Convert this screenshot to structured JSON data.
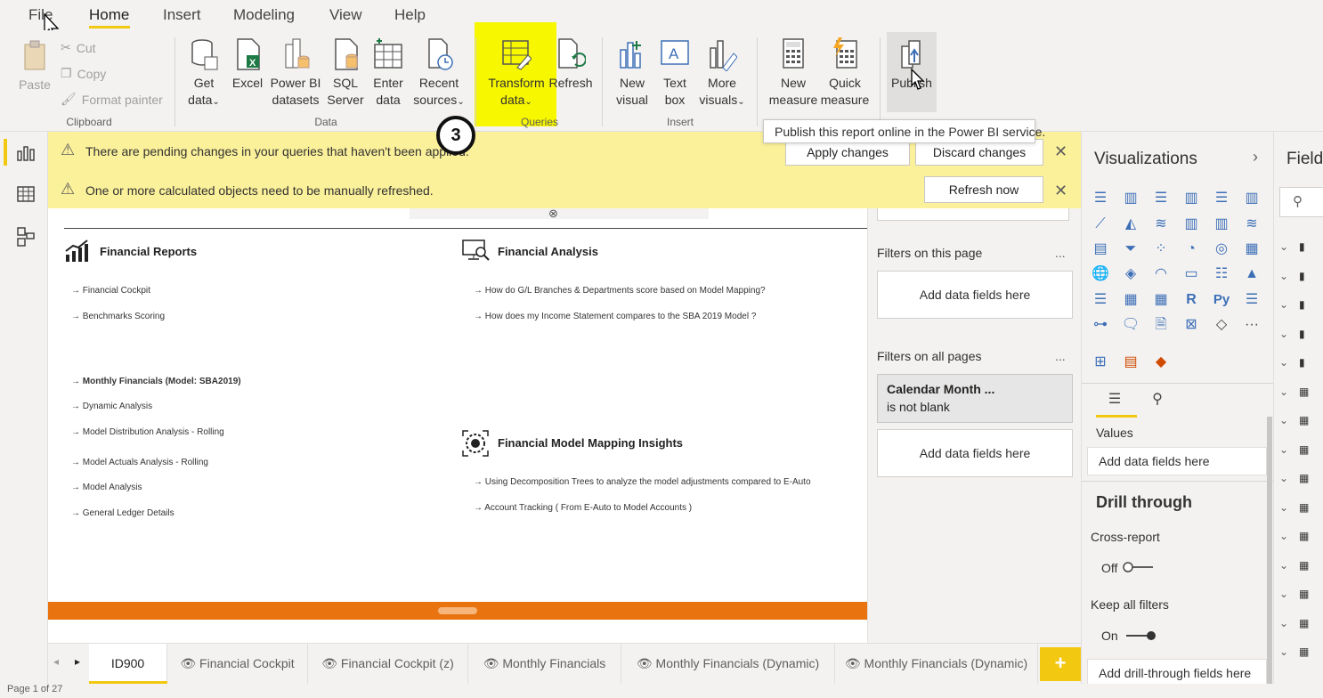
{
  "menu": {
    "file": "File",
    "home": "Home",
    "insert": "Insert",
    "modeling": "Modeling",
    "view": "View",
    "help": "Help"
  },
  "ribbon": {
    "clipboard": {
      "paste": "Paste",
      "cut": "Cut",
      "copy": "Copy",
      "format_painter": "Format painter",
      "group_label": "Clipboard"
    },
    "data": {
      "get_data": [
        "Get",
        "data"
      ],
      "excel": "Excel",
      "power_bi_datasets": [
        "Power BI",
        "datasets"
      ],
      "sql_server": [
        "SQL",
        "Server"
      ],
      "enter_data": [
        "Enter",
        "data"
      ],
      "recent_sources": [
        "Recent",
        "sources"
      ],
      "group_label": "Data"
    },
    "queries": {
      "transform_data": [
        "Transform",
        "data"
      ],
      "refresh": "Refresh",
      "group_label": "Queries"
    },
    "insert": {
      "new_visual": [
        "New",
        "visual"
      ],
      "text_box": [
        "Text",
        "box"
      ],
      "more_visuals": [
        "More",
        "visuals"
      ],
      "group_label": "Insert"
    },
    "calculations": {
      "new_measure": [
        "New",
        "measure"
      ],
      "quick_measure": [
        "Quick",
        "measure"
      ]
    },
    "share": {
      "publish": "Publish"
    }
  },
  "tooltip": "Publish this report online in the Power BI service.",
  "step_badge": "3",
  "banners": {
    "pending": {
      "message": "There are pending changes in your queries that haven't been applied.",
      "apply": "Apply changes",
      "discard": "Discard changes"
    },
    "refresh": {
      "message": "One or more calculated objects need to be manually refreshed.",
      "refresh_now": "Refresh now"
    }
  },
  "report": {
    "financial_reports": {
      "title": "Financial Reports",
      "links": [
        "→ Financial Cockpit",
        "→ Benchmarks Scoring"
      ]
    },
    "monthly": {
      "links": [
        "→ Monthly Financials (Model: SBA2019)",
        "→ Dynamic Analysis",
        "→ Model Distribution Analysis - Rolling",
        "→ Model Actuals Analysis - Rolling",
        "→ Model Analysis",
        "→ General Ledger Details"
      ]
    },
    "financial_analysis": {
      "title": "Financial Analysis",
      "links": [
        "→ How do G/L Branches & Departments score based on Model Mapping?",
        "→ How does my Income Statement compares to the SBA 2019 Model ?"
      ]
    },
    "model_mapping": {
      "title": "Financial Model Mapping Insights",
      "links": [
        "→ Using Decomposition Trees to analyze the model adjustments compared to E-Auto",
        "→ Account Tracking ( From E-Auto to Model Accounts )"
      ]
    }
  },
  "filters": {
    "on_this_page": "Filters on this page",
    "add_fields": "Add data fields here",
    "on_all_pages": "Filters on all pages",
    "card_title": "Calendar Month ...",
    "card_sub": "is not blank",
    "add_fields_2": "Add data fields here",
    "more": "..."
  },
  "visualizations": {
    "title": "Visualizations",
    "values_label": "Values",
    "values_well": "Add data fields here",
    "drill_through": "Drill through",
    "cross_report": "Cross-report",
    "cross_report_state": "Off",
    "keep_all_filters": "Keep all filters",
    "keep_all_filters_state": "On",
    "drill_well": "Add drill-through fields here"
  },
  "fields": {
    "title": "Field"
  },
  "tabs": [
    "ID900",
    "Financial Cockpit",
    "Financial Cockpit (z)",
    "Monthly Financials",
    "Monthly Financials (Dynamic)",
    "Monthly Financials (Dynamic)"
  ],
  "add_page": "+",
  "status": "Page 1 of 27",
  "colors": {
    "accent_yellow": "#f2c811",
    "highlight": "#f7f700",
    "banner": "#fbf19b",
    "orange_bar": "#e8730f"
  }
}
